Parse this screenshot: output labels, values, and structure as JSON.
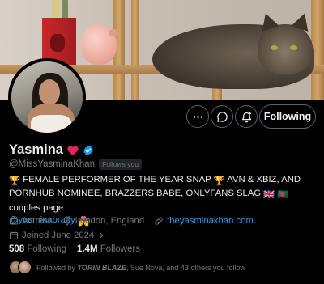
{
  "profile": {
    "display_name": "Yasmina",
    "handle": "@MissYasminaKhan",
    "follows_you_badge": "Follows you",
    "verified": true,
    "name_emoji": "heart-emoji"
  },
  "actions": {
    "more_icon": "more-icon",
    "message_icon": "message-icon",
    "notify_icon": "notify-add-icon",
    "follow_label": "Following"
  },
  "bio": {
    "line1_a": "FEMALE PERFORMER OF THE YEAR SNAP",
    "line1_b": "AVN & XBIZ, AND PORNHUB",
    "line2_a": "NOMINEE, BRAZZERS BABE, ONLYFANS SLAG",
    "line2_b": "couples page",
    "mention": "@yasminabrady"
  },
  "meta": {
    "category": "Actress",
    "location": "London, England",
    "website": "theyasminakhan.com",
    "joined": "Joined June 2024"
  },
  "stats": {
    "following_count": "508",
    "following_label": "Following",
    "followers_count": "1.4M",
    "followers_label": "Followers"
  },
  "followed_by": {
    "prefix": "Followed by",
    "name1": "TORIN BLAZE",
    "rest": ", Sue Nova, and 43 others you follow"
  },
  "colors": {
    "background": "#000000",
    "text_primary": "#e7e9ea",
    "text_secondary": "#71767b",
    "link": "#1d9bf0",
    "border": "#536471",
    "verified": "#1d9bf0"
  }
}
